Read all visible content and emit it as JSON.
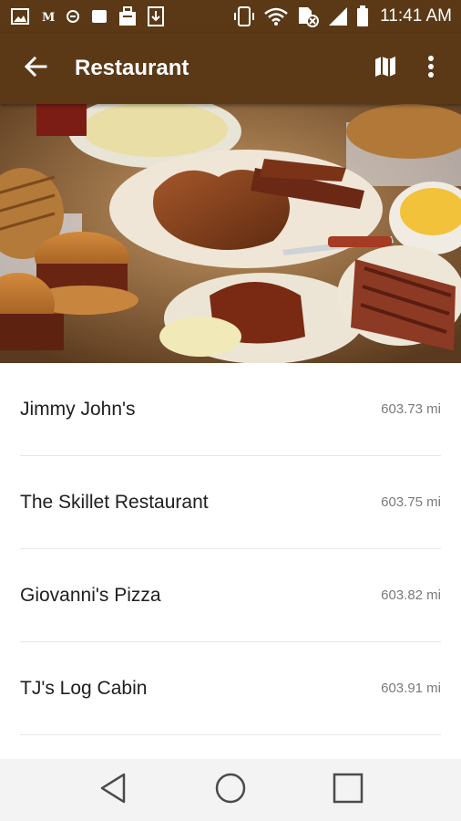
{
  "status_bar": {
    "time": "11:41 AM",
    "icons": [
      "image-icon",
      "m-app-icon",
      "circle-app-icon",
      "square-icon",
      "briefcase-icon",
      "download-icon",
      "vibrate-icon",
      "wifi-icon",
      "data-saver-icon",
      "signal-icon",
      "battery-icon"
    ]
  },
  "app_bar": {
    "title": "Restaurant",
    "back_icon": "back-arrow-icon",
    "actions": [
      "map-icon",
      "more-vert-icon"
    ]
  },
  "hero": {
    "image": "bbq-food-platter-photo"
  },
  "restaurants": [
    {
      "name": "Jimmy John's",
      "distance": "603.73 mi"
    },
    {
      "name": "The Skillet Restaurant",
      "distance": "603.75 mi"
    },
    {
      "name": "Giovanni's Pizza",
      "distance": "603.82 mi"
    },
    {
      "name": "TJ's Log Cabin",
      "distance": "603.91 mi"
    }
  ],
  "nav_bar": {
    "buttons": [
      "back-triangle-icon",
      "home-circle-icon",
      "recents-square-icon"
    ]
  },
  "colors": {
    "primary": "#5b3916",
    "text": "#202020",
    "secondary_text": "#7a7a7a",
    "nav_background": "#f3f3f3"
  }
}
